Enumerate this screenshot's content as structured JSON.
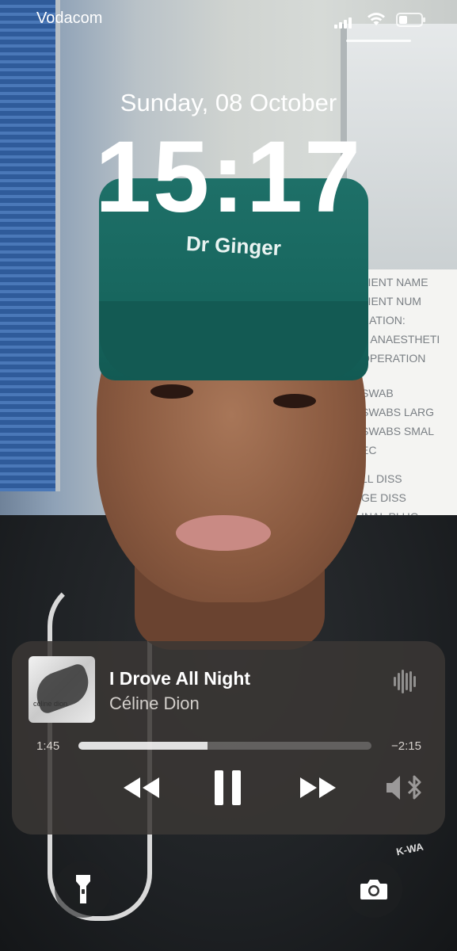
{
  "status_bar": {
    "carrier": "Vodacom",
    "icons": [
      "cellular-signal-icon",
      "wifi-icon",
      "battery-icon"
    ]
  },
  "lock_screen": {
    "date": "Sunday, 08 October",
    "time": "15:17"
  },
  "wallpaper": {
    "cap_text": "Dr Ginger",
    "board_lines": [
      "TIENT NAME",
      "TIENT NUM",
      "RATION:",
      "T ANAESTHETI",
      "OPERATION",
      "SWAB",
      "SWABS LARG",
      "SWABS SMAL",
      "EC",
      "LL DISS",
      "GE DISS",
      "INAL PLUG"
    ],
    "jacket_text": "K-WA"
  },
  "now_playing": {
    "album_art_text": "celine dion",
    "title": "I Drove All Night",
    "artist": "Céline Dion",
    "elapsed": "1:45",
    "remaining": "−2:15",
    "progress": 0.44,
    "controls": [
      "rewind-icon",
      "pause-icon",
      "fast-forward-icon",
      "audio-output-icon"
    ]
  },
  "quick_actions": [
    "flashlight-icon",
    "camera-icon"
  ],
  "colors": {
    "player_bg": "#3a3734",
    "cap_green": "#1e7068",
    "text": "#ffffff"
  }
}
